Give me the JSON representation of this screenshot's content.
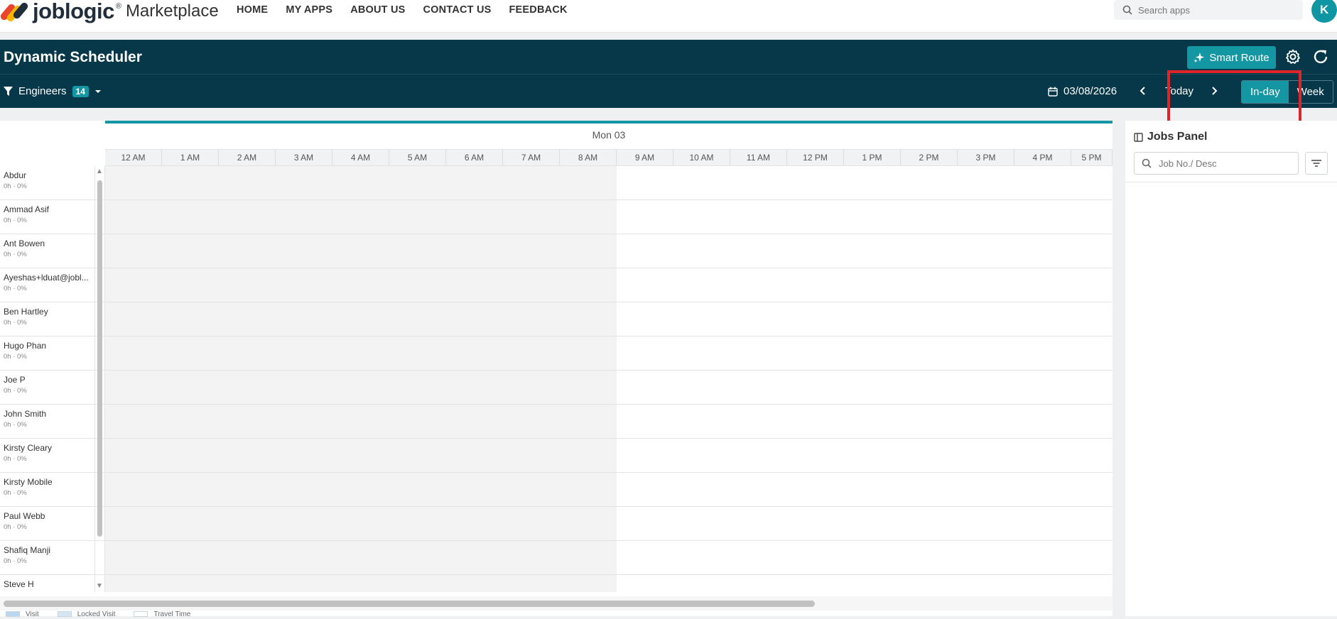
{
  "nav": {
    "logo_word": "joblogic",
    "logo_reg": "®",
    "logo_market": "Marketplace",
    "links": [
      "HOME",
      "MY APPS",
      "ABOUT US",
      "CONTACT US",
      "FEEDBACK"
    ],
    "search_placeholder": "Search apps",
    "avatar": "K"
  },
  "header": {
    "title": "Dynamic Scheduler",
    "smart_route": "Smart Route",
    "filter_label": "Engineers",
    "filter_count": "14",
    "date": "03/08/2026",
    "today": "Today",
    "view_inday": "In-day",
    "view_week": "Week"
  },
  "scheduler": {
    "day": "Mon 03",
    "hours": [
      "12 AM",
      "1 AM",
      "2 AM",
      "3 AM",
      "4 AM",
      "5 AM",
      "6 AM",
      "7 AM",
      "8 AM",
      "9 AM",
      "10 AM",
      "11 AM",
      "12 PM",
      "1 PM",
      "2 PM",
      "3 PM",
      "4 PM",
      "5 PM"
    ],
    "engineers": [
      {
        "name": "Abdur",
        "stat": "0h · 0%"
      },
      {
        "name": "Ammad Asif",
        "stat": "0h · 0%"
      },
      {
        "name": "Ant Bowen",
        "stat": "0h · 0%"
      },
      {
        "name": "Ayeshas+lduat@jobl...",
        "stat": "0h · 0%"
      },
      {
        "name": "Ben Hartley",
        "stat": "0h · 0%"
      },
      {
        "name": "Hugo Phan",
        "stat": "0h · 0%"
      },
      {
        "name": "Joe P",
        "stat": "0h · 0%"
      },
      {
        "name": "John Smith",
        "stat": "0h · 0%"
      },
      {
        "name": "Kirsty Cleary",
        "stat": "0h · 0%"
      },
      {
        "name": "Kirsty Mobile",
        "stat": "0h · 0%"
      },
      {
        "name": "Paul Webb",
        "stat": "0h · 0%"
      },
      {
        "name": "Shafiq Manji",
        "stat": "0h · 0%"
      },
      {
        "name": "Steve H",
        "stat": ""
      }
    ],
    "legend": [
      {
        "label": "Visit",
        "color": "#b9d8ef"
      },
      {
        "label": "Locked Visit",
        "color": "#d4e6f3"
      },
      {
        "label": "Travel Time",
        "color": "#ffffff"
      }
    ]
  },
  "jobs_panel": {
    "title": "Jobs Panel",
    "search_placeholder": "Job No./ Desc"
  },
  "colors": {
    "header_bg": "#06384a",
    "accent": "#1497a2",
    "highlight": "#e0242a"
  },
  "icons": [
    "search-icon",
    "sparkle-icon",
    "gear-icon",
    "refresh-icon",
    "filter-icon",
    "caret-down-icon",
    "calendar-icon",
    "chevron-left-icon",
    "chevron-right-icon",
    "panel-icon",
    "filter-lines-icon"
  ]
}
